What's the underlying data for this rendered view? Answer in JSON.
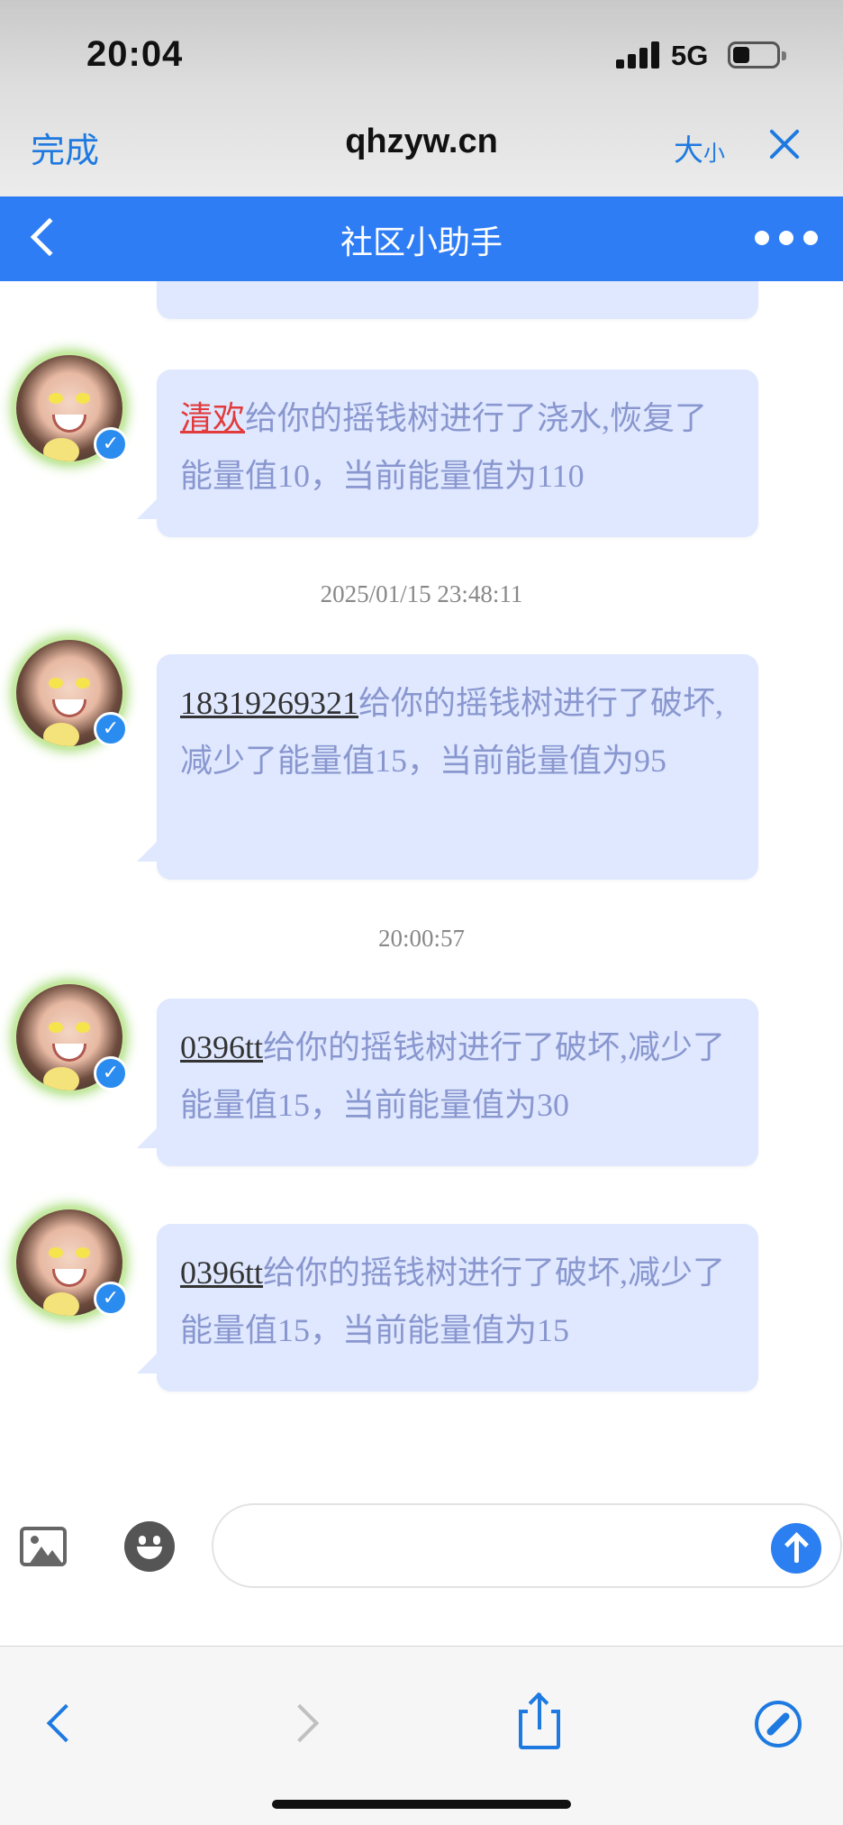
{
  "status_bar": {
    "time": "20:04",
    "network": "5G"
  },
  "browser": {
    "done_label": "完成",
    "domain": "qhzyw.cn",
    "size_label_large": "大",
    "size_label_small": "小"
  },
  "header": {
    "title": "社区小助手"
  },
  "messages": [
    {
      "timestamp": "",
      "user": "清欢",
      "user_color": "#e23b3b",
      "text": "给你的摇钱树进行了浇水,恢复了能量值10，当前能量值为110"
    },
    {
      "timestamp": "2025/01/15 23:48:11",
      "user": "18319269321",
      "text": "给你的摇钱树进行了破坏,减少了能量值15，当前能量值为95"
    },
    {
      "timestamp": "20:00:57",
      "user": "0396tt",
      "text": "给你的摇钱树进行了破坏,减少了能量值15，当前能量值为30"
    },
    {
      "timestamp": "",
      "user": "0396tt",
      "text": "给你的摇钱树进行了破坏,减少了能量值15，当前能量值为15"
    }
  ],
  "input": {
    "placeholder": ""
  },
  "colors": {
    "accent": "#2f7df5",
    "bubble": "#dfe8ff",
    "bubble_text": "#8a97cf"
  },
  "icons": {
    "back": "chevron-left-icon",
    "more": "more-dots-icon",
    "image": "image-icon",
    "emoji": "emoji-icon",
    "send": "send-arrow-icon",
    "share": "share-icon",
    "compass": "compass-icon"
  }
}
